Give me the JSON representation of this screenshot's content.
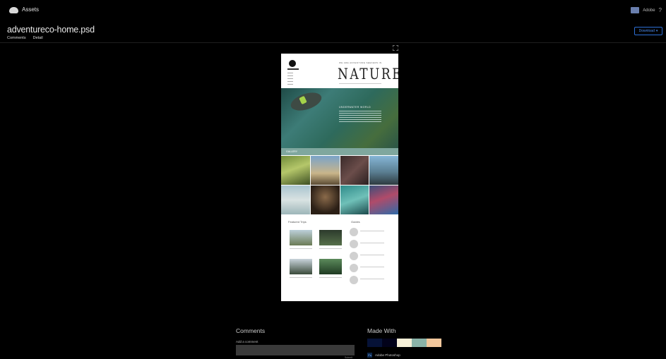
{
  "app": {
    "title": "Assets"
  },
  "user": {
    "name": "Adobe"
  },
  "file": {
    "name": "adventureco-home.psd"
  },
  "tabs": [
    {
      "label": "Comments",
      "active": true
    },
    {
      "label": "Detail",
      "active": false
    }
  ],
  "download": {
    "label": "Download"
  },
  "preview": {
    "tagline": "WE ARE ADVENTURE SEEKERS IN",
    "headline": "NATURE",
    "hero_title": "UNDERWATER WORLD",
    "band_label": "GALLERY",
    "left_title": "Featured Trips",
    "right_title": "Guides"
  },
  "comments": {
    "title": "Comments",
    "input_label": "Add a comment",
    "submit": "Submit"
  },
  "made_with": {
    "title": "Made With",
    "app_name": "Adobe Photoshop",
    "app_abbr": "Ps",
    "swatches": [
      "#061237",
      "#02021a",
      "#f6f0d8",
      "#8ab3a8",
      "#f3c89d"
    ]
  }
}
